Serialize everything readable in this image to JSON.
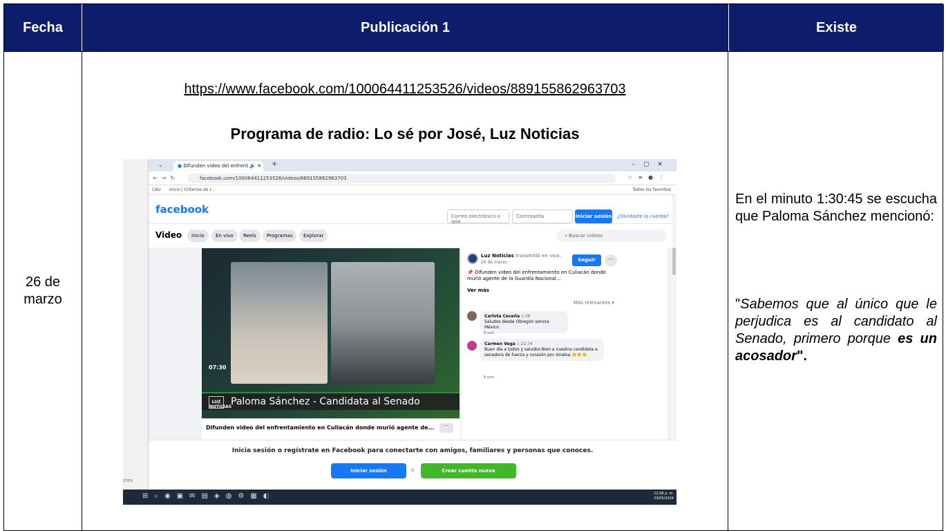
{
  "headers": {
    "fecha": "Fecha",
    "publicacion": "Publicación 1",
    "existe": "Existe"
  },
  "row": {
    "date": "26 de marzo",
    "url": "https://www.facebook.com/100064411253526/videos/889155862963703",
    "title": "Programa de radio: Lo sé por José, Luz Noticias",
    "existe_intro": "En el minuto 1:30:45 se escucha que Paloma Sánchez mencionó:",
    "quote_open": "\"",
    "quote_main": "Sabemos que al único que le perjudica es al candidato al Senado, primero porque ",
    "quote_bold": "es un acosador",
    "quote_close": "\".",
    "screenshot": {
      "tab_title": "Difunden video del enfrent",
      "address": "facebook.com/100064411253526/videos/889155862963703",
      "bookmarks": [
        "CAU",
        "Inicio | Criterios de I..."
      ],
      "bookmarks_right": "Todos los favoritos",
      "fb_logo": "facebook",
      "email_placeholder": "Correo electrónico o telé",
      "password_placeholder": "Contraseña",
      "login_label": "Iniciar sesión",
      "forgot_label": "¿Olvidaste la cuenta?",
      "video_section": "Video",
      "nav_pills": [
        "Inicio",
        "En vivo",
        "Reels",
        "Programas",
        "Explorar"
      ],
      "search_placeholder": "Buscar videos",
      "video_time": "07:30",
      "video_logo": "LUZ NOTICIAS",
      "video_caption": "Paloma Sánchez - Candidata al Senado",
      "video_title": "Difunden video del enfrentamiento en Culiacán donde murió agente de...",
      "channel_name": "Luz Noticias",
      "channel_action": "transmitió en vivo.",
      "channel_date": "26 de marzo ·",
      "follow_label": "Seguir",
      "post_text": "📌 Difunden video del enfrentamiento en Culiacán donde murió agente de la Guardia Nacional...",
      "see_more": "Ver más",
      "relevance": "Más relevantes ▾",
      "comments": [
        {
          "author": "Carlota Ceceña",
          "time": "1:38",
          "text": "Saludos desde Obregón sonora México",
          "age": "8 sem"
        },
        {
          "author": "Carmen Vega",
          "time": "1:22:34",
          "text": "Buen día a todos y saludos Bien a nuestra candidata a senadora de fuerza y corazón por sinaloa 👏👏👏",
          "age": "8 sem"
        }
      ],
      "bottom_text": "Inicia sesión o regístrate en Facebook para conectarte con amigos, familiares y personas que conoces.",
      "bottom_login": "Iniciar sesión",
      "bottom_or": "o",
      "bottom_create": "Crear cuenta nueva",
      "zoom": "270%",
      "clock_time": "12:06 p. m.",
      "clock_date": "23/05/2024"
    }
  }
}
